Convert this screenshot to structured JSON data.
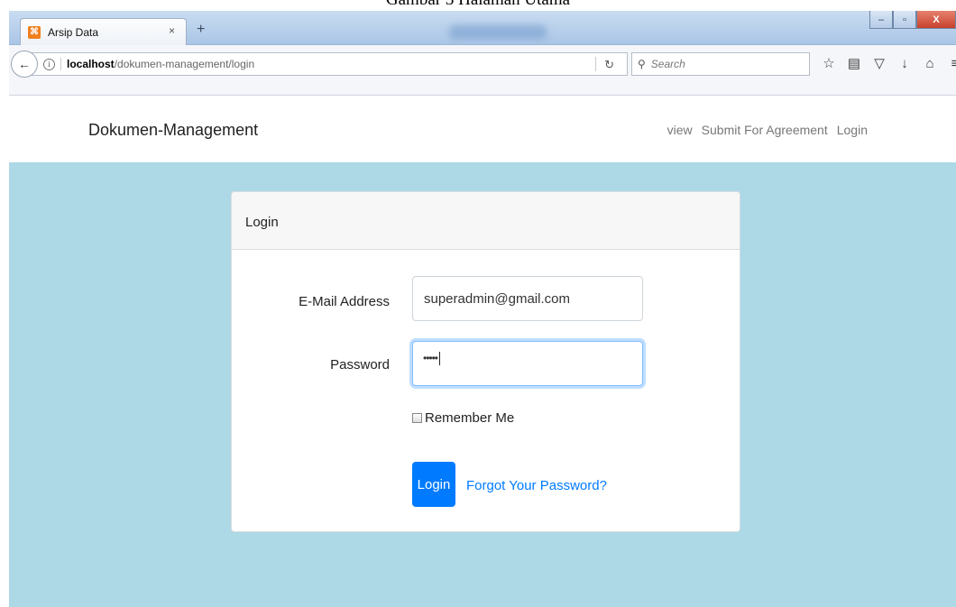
{
  "caption": "Gambar 3 Halaman Utama",
  "browser": {
    "tab_title": "Arsip Data",
    "tab_close": "×",
    "new_tab": "+",
    "url_host": "localhost",
    "url_path": "/dokumen-management/login",
    "search_placeholder": "Search",
    "window_controls": {
      "minimize": "–",
      "maximize": "▫",
      "close": "X"
    },
    "toolbar_icons": [
      "star-icon",
      "reading-list-icon",
      "pocket-icon",
      "download-icon",
      "home-icon",
      "menu-icon"
    ]
  },
  "app": {
    "brand": "Dokumen-Management",
    "nav_links": [
      "view",
      "Submit For Agreement",
      "Login"
    ]
  },
  "login_card": {
    "header": "Login",
    "email_label": "E-Mail Address",
    "email_value": "superadmin@gmail.com",
    "password_label": "Password",
    "password_value": "•••••",
    "remember_label": "Remember Me",
    "login_button": "Login",
    "forgot_link": "Forgot Your Password?"
  },
  "colors": {
    "content_background": "#add8e6",
    "primary": "#007bff",
    "favicon": "#f07f1e"
  }
}
